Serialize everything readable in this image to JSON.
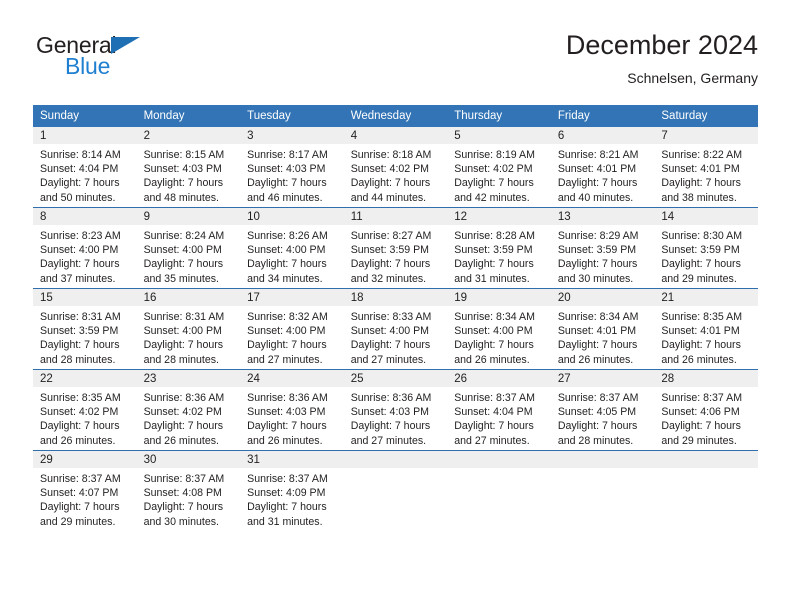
{
  "brand": {
    "name_part1": "General",
    "name_part2": "Blue",
    "triangle_icon": "triangle-icon",
    "accent_color": "#1f7fd0"
  },
  "header": {
    "title": "December 2024",
    "subtitle": "Schnelsen, Germany"
  },
  "theme": {
    "header_blue": "#3274b5",
    "row_divider_blue": "#2f6fae",
    "daynum_band_gray": "#efefef",
    "text_color": "#231f20"
  },
  "calendar": {
    "weekday_headers": [
      "Sunday",
      "Monday",
      "Tuesday",
      "Wednesday",
      "Thursday",
      "Friday",
      "Saturday"
    ],
    "weeks": [
      [
        {
          "day": "1",
          "sunrise": "Sunrise: 8:14 AM",
          "sunset": "Sunset: 4:04 PM",
          "daylight_line1": "Daylight: 7 hours",
          "daylight_line2": "and 50 minutes."
        },
        {
          "day": "2",
          "sunrise": "Sunrise: 8:15 AM",
          "sunset": "Sunset: 4:03 PM",
          "daylight_line1": "Daylight: 7 hours",
          "daylight_line2": "and 48 minutes."
        },
        {
          "day": "3",
          "sunrise": "Sunrise: 8:17 AM",
          "sunset": "Sunset: 4:03 PM",
          "daylight_line1": "Daylight: 7 hours",
          "daylight_line2": "and 46 minutes."
        },
        {
          "day": "4",
          "sunrise": "Sunrise: 8:18 AM",
          "sunset": "Sunset: 4:02 PM",
          "daylight_line1": "Daylight: 7 hours",
          "daylight_line2": "and 44 minutes."
        },
        {
          "day": "5",
          "sunrise": "Sunrise: 8:19 AM",
          "sunset": "Sunset: 4:02 PM",
          "daylight_line1": "Daylight: 7 hours",
          "daylight_line2": "and 42 minutes."
        },
        {
          "day": "6",
          "sunrise": "Sunrise: 8:21 AM",
          "sunset": "Sunset: 4:01 PM",
          "daylight_line1": "Daylight: 7 hours",
          "daylight_line2": "and 40 minutes."
        },
        {
          "day": "7",
          "sunrise": "Sunrise: 8:22 AM",
          "sunset": "Sunset: 4:01 PM",
          "daylight_line1": "Daylight: 7 hours",
          "daylight_line2": "and 38 minutes."
        }
      ],
      [
        {
          "day": "8",
          "sunrise": "Sunrise: 8:23 AM",
          "sunset": "Sunset: 4:00 PM",
          "daylight_line1": "Daylight: 7 hours",
          "daylight_line2": "and 37 minutes."
        },
        {
          "day": "9",
          "sunrise": "Sunrise: 8:24 AM",
          "sunset": "Sunset: 4:00 PM",
          "daylight_line1": "Daylight: 7 hours",
          "daylight_line2": "and 35 minutes."
        },
        {
          "day": "10",
          "sunrise": "Sunrise: 8:26 AM",
          "sunset": "Sunset: 4:00 PM",
          "daylight_line1": "Daylight: 7 hours",
          "daylight_line2": "and 34 minutes."
        },
        {
          "day": "11",
          "sunrise": "Sunrise: 8:27 AM",
          "sunset": "Sunset: 3:59 PM",
          "daylight_line1": "Daylight: 7 hours",
          "daylight_line2": "and 32 minutes."
        },
        {
          "day": "12",
          "sunrise": "Sunrise: 8:28 AM",
          "sunset": "Sunset: 3:59 PM",
          "daylight_line1": "Daylight: 7 hours",
          "daylight_line2": "and 31 minutes."
        },
        {
          "day": "13",
          "sunrise": "Sunrise: 8:29 AM",
          "sunset": "Sunset: 3:59 PM",
          "daylight_line1": "Daylight: 7 hours",
          "daylight_line2": "and 30 minutes."
        },
        {
          "day": "14",
          "sunrise": "Sunrise: 8:30 AM",
          "sunset": "Sunset: 3:59 PM",
          "daylight_line1": "Daylight: 7 hours",
          "daylight_line2": "and 29 minutes."
        }
      ],
      [
        {
          "day": "15",
          "sunrise": "Sunrise: 8:31 AM",
          "sunset": "Sunset: 3:59 PM",
          "daylight_line1": "Daylight: 7 hours",
          "daylight_line2": "and 28 minutes."
        },
        {
          "day": "16",
          "sunrise": "Sunrise: 8:31 AM",
          "sunset": "Sunset: 4:00 PM",
          "daylight_line1": "Daylight: 7 hours",
          "daylight_line2": "and 28 minutes."
        },
        {
          "day": "17",
          "sunrise": "Sunrise: 8:32 AM",
          "sunset": "Sunset: 4:00 PM",
          "daylight_line1": "Daylight: 7 hours",
          "daylight_line2": "and 27 minutes."
        },
        {
          "day": "18",
          "sunrise": "Sunrise: 8:33 AM",
          "sunset": "Sunset: 4:00 PM",
          "daylight_line1": "Daylight: 7 hours",
          "daylight_line2": "and 27 minutes."
        },
        {
          "day": "19",
          "sunrise": "Sunrise: 8:34 AM",
          "sunset": "Sunset: 4:00 PM",
          "daylight_line1": "Daylight: 7 hours",
          "daylight_line2": "and 26 minutes."
        },
        {
          "day": "20",
          "sunrise": "Sunrise: 8:34 AM",
          "sunset": "Sunset: 4:01 PM",
          "daylight_line1": "Daylight: 7 hours",
          "daylight_line2": "and 26 minutes."
        },
        {
          "day": "21",
          "sunrise": "Sunrise: 8:35 AM",
          "sunset": "Sunset: 4:01 PM",
          "daylight_line1": "Daylight: 7 hours",
          "daylight_line2": "and 26 minutes."
        }
      ],
      [
        {
          "day": "22",
          "sunrise": "Sunrise: 8:35 AM",
          "sunset": "Sunset: 4:02 PM",
          "daylight_line1": "Daylight: 7 hours",
          "daylight_line2": "and 26 minutes."
        },
        {
          "day": "23",
          "sunrise": "Sunrise: 8:36 AM",
          "sunset": "Sunset: 4:02 PM",
          "daylight_line1": "Daylight: 7 hours",
          "daylight_line2": "and 26 minutes."
        },
        {
          "day": "24",
          "sunrise": "Sunrise: 8:36 AM",
          "sunset": "Sunset: 4:03 PM",
          "daylight_line1": "Daylight: 7 hours",
          "daylight_line2": "and 26 minutes."
        },
        {
          "day": "25",
          "sunrise": "Sunrise: 8:36 AM",
          "sunset": "Sunset: 4:03 PM",
          "daylight_line1": "Daylight: 7 hours",
          "daylight_line2": "and 27 minutes."
        },
        {
          "day": "26",
          "sunrise": "Sunrise: 8:37 AM",
          "sunset": "Sunset: 4:04 PM",
          "daylight_line1": "Daylight: 7 hours",
          "daylight_line2": "and 27 minutes."
        },
        {
          "day": "27",
          "sunrise": "Sunrise: 8:37 AM",
          "sunset": "Sunset: 4:05 PM",
          "daylight_line1": "Daylight: 7 hours",
          "daylight_line2": "and 28 minutes."
        },
        {
          "day": "28",
          "sunrise": "Sunrise: 8:37 AM",
          "sunset": "Sunset: 4:06 PM",
          "daylight_line1": "Daylight: 7 hours",
          "daylight_line2": "and 29 minutes."
        }
      ],
      [
        {
          "day": "29",
          "sunrise": "Sunrise: 8:37 AM",
          "sunset": "Sunset: 4:07 PM",
          "daylight_line1": "Daylight: 7 hours",
          "daylight_line2": "and 29 minutes."
        },
        {
          "day": "30",
          "sunrise": "Sunrise: 8:37 AM",
          "sunset": "Sunset: 4:08 PM",
          "daylight_line1": "Daylight: 7 hours",
          "daylight_line2": "and 30 minutes."
        },
        {
          "day": "31",
          "sunrise": "Sunrise: 8:37 AM",
          "sunset": "Sunset: 4:09 PM",
          "daylight_line1": "Daylight: 7 hours",
          "daylight_line2": "and 31 minutes."
        },
        {
          "day": "",
          "sunrise": "",
          "sunset": "",
          "daylight_line1": "",
          "daylight_line2": ""
        },
        {
          "day": "",
          "sunrise": "",
          "sunset": "",
          "daylight_line1": "",
          "daylight_line2": ""
        },
        {
          "day": "",
          "sunrise": "",
          "sunset": "",
          "daylight_line1": "",
          "daylight_line2": ""
        },
        {
          "day": "",
          "sunrise": "",
          "sunset": "",
          "daylight_line1": "",
          "daylight_line2": ""
        }
      ]
    ]
  }
}
